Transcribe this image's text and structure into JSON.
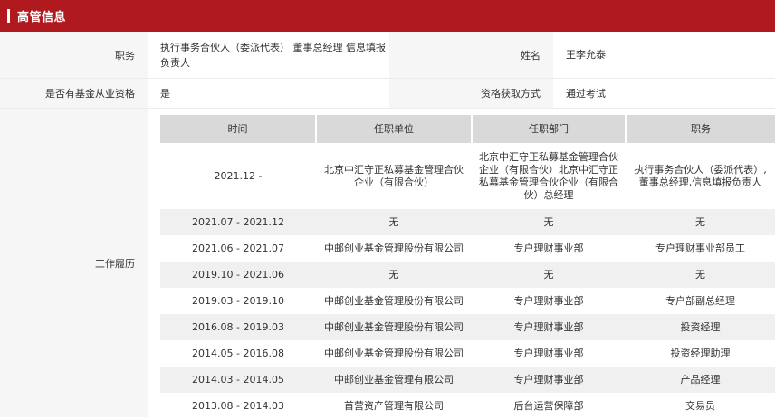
{
  "header": {
    "title": "高管信息"
  },
  "info": {
    "position_label": "职务",
    "position_value": "执行事务合伙人（委派代表） 董事总经理 信息填报负责人",
    "name_label": "姓名",
    "name_value": "王李允泰",
    "qualified_label": "是否有基金从业资格",
    "qualified_value": "是",
    "method_label": "资格获取方式",
    "method_value": "通过考试",
    "history_label": "工作履历"
  },
  "history": {
    "columns": [
      "时间",
      "任职单位",
      "任职部门",
      "职务"
    ],
    "rows": [
      [
        "2021.12 -",
        "北京中汇守正私募基金管理合伙企业（有限合伙）",
        "北京中汇守正私募基金管理合伙企业（有限合伙）北京中汇守正私募基金管理合伙企业（有限合伙）总经理",
        "执行事务合伙人（委派代表）,董事总经理,信息填报负责人"
      ],
      [
        "2021.07 - 2021.12",
        "无",
        "无",
        "无"
      ],
      [
        "2021.06 - 2021.07",
        "中邮创业基金管理股份有限公司",
        "专户理财事业部",
        "专户理财事业部员工"
      ],
      [
        "2019.10 - 2021.06",
        "无",
        "无",
        "无"
      ],
      [
        "2019.03 - 2019.10",
        "中邮创业基金管理股份有限公司",
        "专户理财事业部",
        "专户部副总经理"
      ],
      [
        "2016.08 - 2019.03",
        "中邮创业基金管理股份有限公司",
        "专户理财事业部",
        "投资经理"
      ],
      [
        "2014.05 - 2016.08",
        "中邮创业基金管理股份有限公司",
        "专户理财事业部",
        "投资经理助理"
      ],
      [
        "2014.03 - 2014.05",
        "中邮创业基金管理有限公司",
        "专户理财事业部",
        "产品经理"
      ],
      [
        "2013.08 - 2014.03",
        "首营资产管理有限公司",
        "后台运营保障部",
        "交易员"
      ]
    ]
  }
}
